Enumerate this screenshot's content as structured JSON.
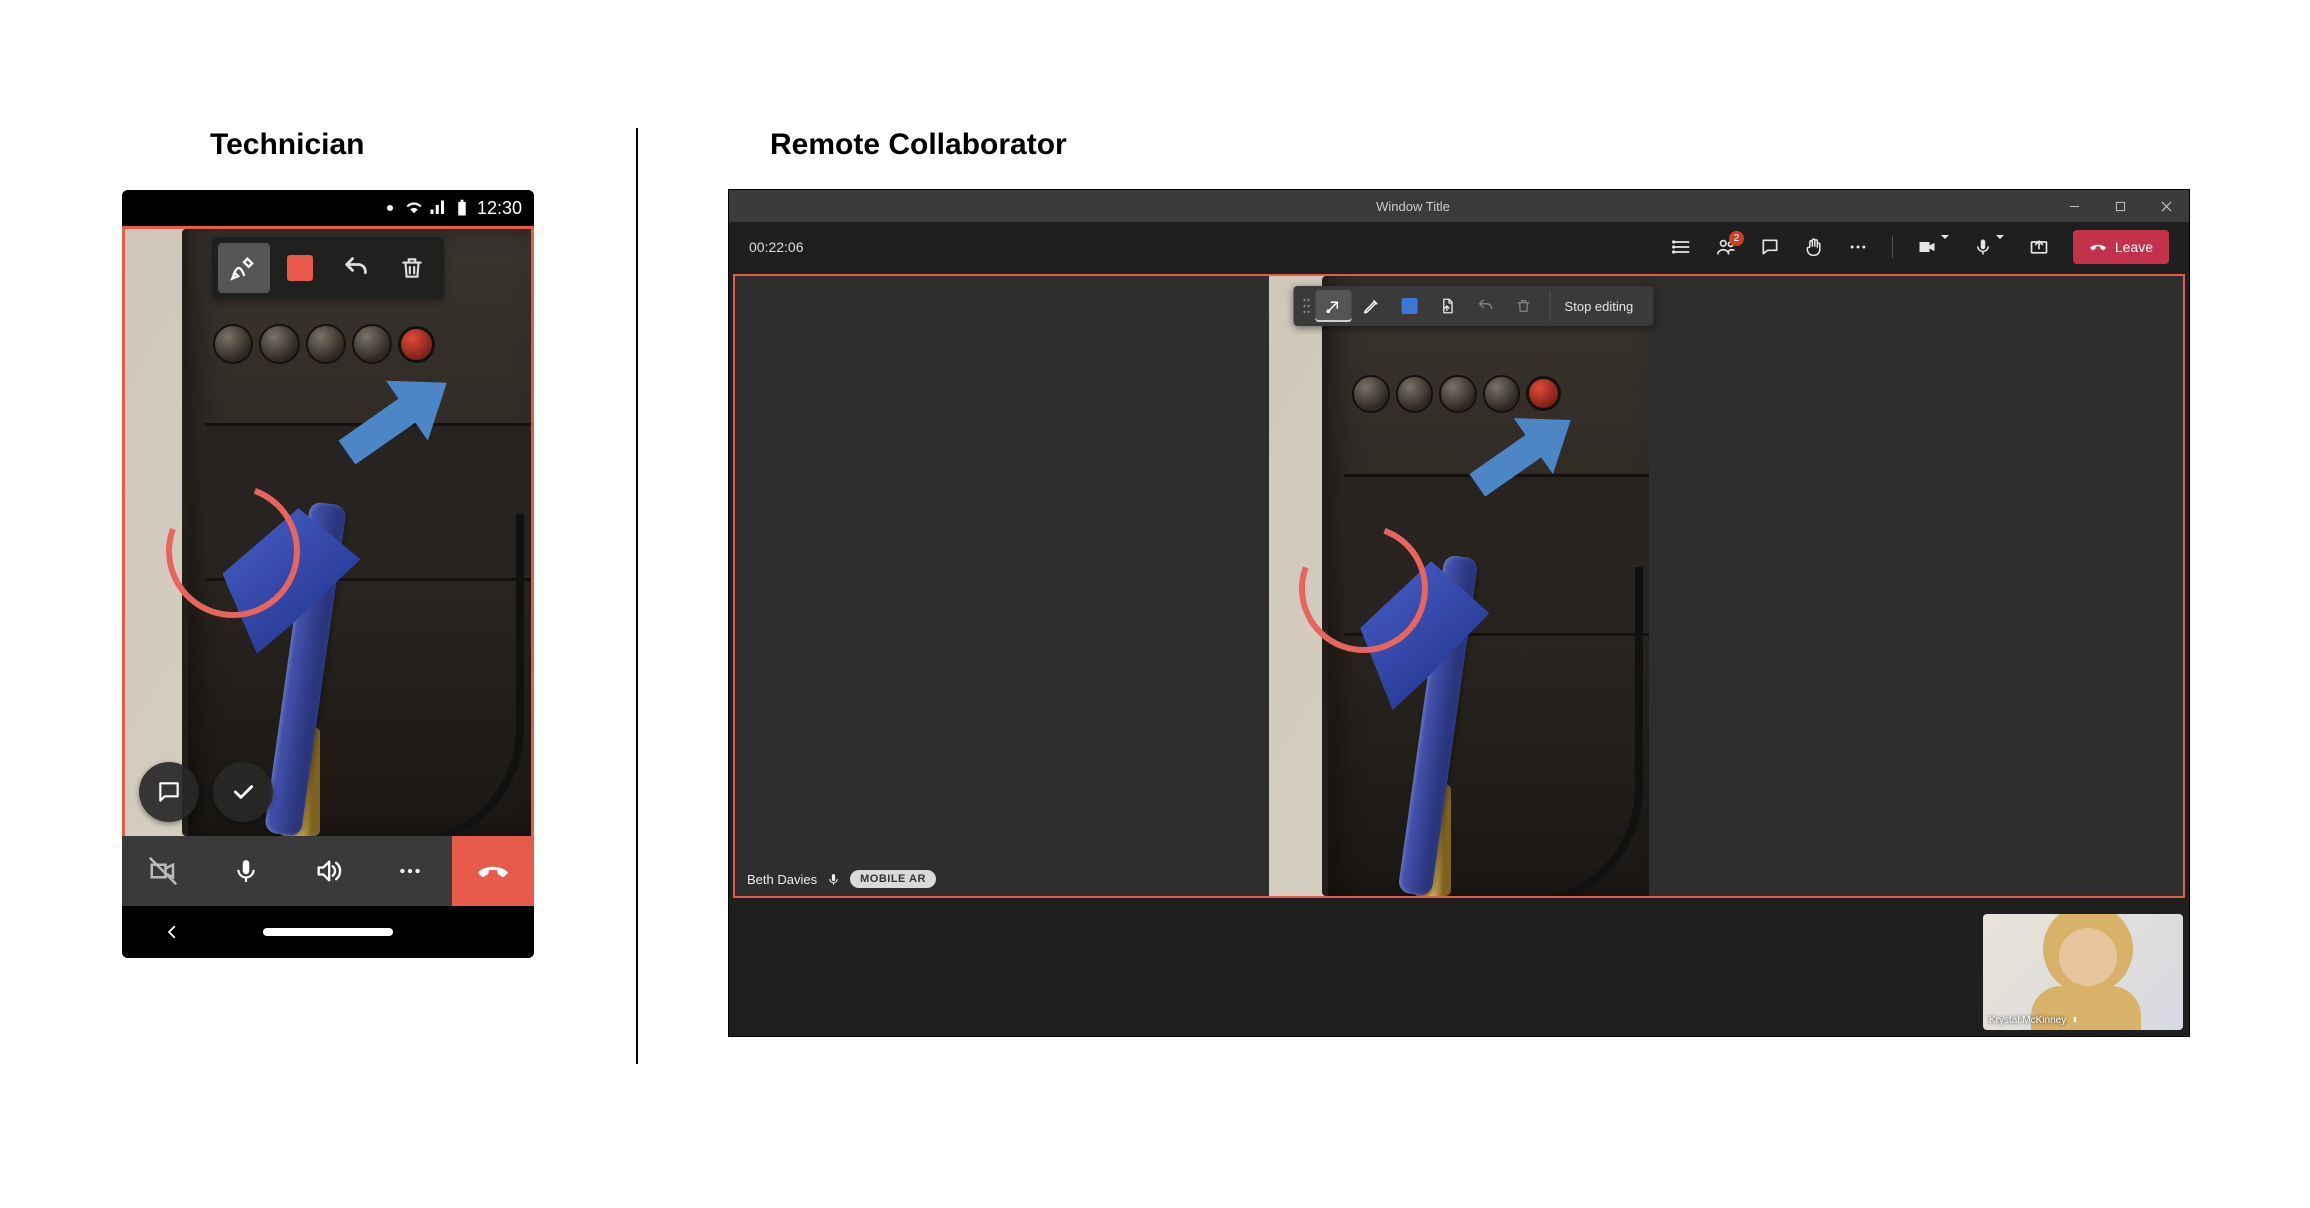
{
  "labels": {
    "technician": "Technician",
    "remote": "Remote Collaborator"
  },
  "phone": {
    "status_time": "12:30",
    "annotation": {
      "pen": "pen",
      "color_hex": "#e85a4a",
      "undo": "undo",
      "delete": "delete"
    },
    "float": {
      "chat": "chat",
      "confirm": "confirm"
    },
    "callbar": {
      "video": "video-off",
      "mic": "mic",
      "speaker": "speaker",
      "more": "more",
      "hang": "hang-up"
    }
  },
  "desktop": {
    "window_title": "Window Title",
    "timer": "00:22:06",
    "toolbar": {
      "badge_count": "2",
      "leave_label": "Leave"
    },
    "anno": {
      "stop_edit": "Stop editing",
      "color_hex": "#3a78d6"
    },
    "presenter": {
      "name": "Beth Davies",
      "mode": "MOBILE AR"
    },
    "pip_name": "Krystal McKinney"
  },
  "colors": {
    "accent_red": "#e85a4a",
    "leave_red": "#c4314b",
    "anno_blue": "#3a78d6",
    "circle_pink": "#e8655f",
    "arrow_blue": "#4d86c6"
  }
}
